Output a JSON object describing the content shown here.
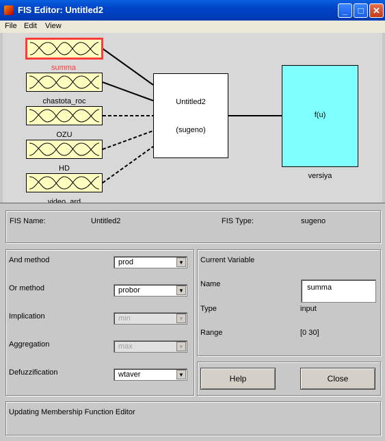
{
  "window": {
    "title": "FIS Editor: Untitled2"
  },
  "menu": {
    "items": [
      "File",
      "Edit",
      "View"
    ]
  },
  "inputs": [
    {
      "name": "summa",
      "selected": true
    },
    {
      "name": "chastota_roc",
      "selected": false
    },
    {
      "name": "OZU",
      "selected": false
    },
    {
      "name": "HD",
      "selected": false
    },
    {
      "name": "video_ard",
      "selected": false
    }
  ],
  "fis_block": {
    "name": "Untitled2",
    "type": "(sugeno)"
  },
  "output": {
    "func": "f(u)",
    "name": "versiya"
  },
  "info": {
    "fis_name_label": "FIS Name:",
    "fis_name": "Untitled2",
    "fis_type_label": "FIS Type:",
    "fis_type": "sugeno"
  },
  "methods": [
    {
      "label": "And method",
      "value": "prod",
      "enabled": true
    },
    {
      "label": "Or method",
      "value": "probor",
      "enabled": true
    },
    {
      "label": "Implication",
      "value": "min",
      "enabled": false
    },
    {
      "label": "Aggregation",
      "value": "max",
      "enabled": false
    },
    {
      "label": "Defuzzification",
      "value": "wtaver",
      "enabled": true
    }
  ],
  "current_variable": {
    "header": "Current Variable",
    "name_label": "Name",
    "name": "summa",
    "type_label": "Type",
    "type": "input",
    "range_label": "Range",
    "range": "[0 30]"
  },
  "buttons": {
    "help": "Help",
    "close": "Close"
  },
  "status": "Updating Membership Function Editor",
  "colors": {
    "selected_border": "#ff3c3c",
    "input_fill": "#ffffc0",
    "output_fill": "#80ffff"
  }
}
